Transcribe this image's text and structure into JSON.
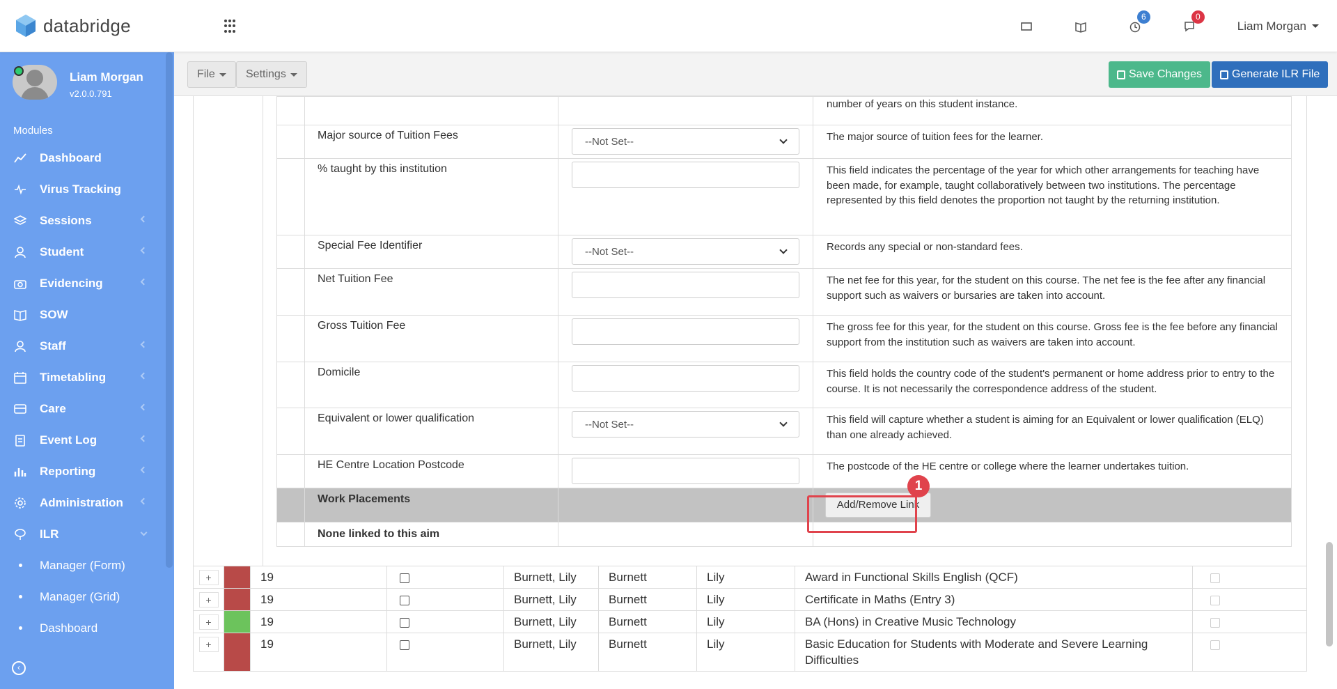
{
  "header": {
    "brand": "databridge",
    "notifications": {
      "timers_badge": "6",
      "messages_badge": "0"
    },
    "user_name": "Liam Morgan"
  },
  "sidebar": {
    "profile": {
      "name": "Liam Morgan",
      "version": "v2.0.0.791"
    },
    "modules_label": "Modules",
    "items": [
      {
        "label": "Dashboard",
        "icon": "chart-line-icon",
        "has_children": false
      },
      {
        "label": "Virus Tracking",
        "icon": "heartbeat-icon",
        "has_children": false
      },
      {
        "label": "Sessions",
        "icon": "layers-icon",
        "has_children": true
      },
      {
        "label": "Student",
        "icon": "user-icon",
        "has_children": true
      },
      {
        "label": "Evidencing",
        "icon": "camera-icon",
        "has_children": true
      },
      {
        "label": "SOW",
        "icon": "book-icon",
        "has_children": false
      },
      {
        "label": "Staff",
        "icon": "user-icon",
        "has_children": true
      },
      {
        "label": "Timetabling",
        "icon": "calendar-icon",
        "has_children": true
      },
      {
        "label": "Care",
        "icon": "id-card-icon",
        "has_children": true
      },
      {
        "label": "Event Log",
        "icon": "clipboard-icon",
        "has_children": true
      },
      {
        "label": "Reporting",
        "icon": "bar-chart-icon",
        "has_children": true
      },
      {
        "label": "Administration",
        "icon": "gear-icon",
        "has_children": true
      },
      {
        "label": "ILR",
        "icon": "balloon-icon",
        "has_children": true
      }
    ],
    "sub_items": [
      {
        "label": "Manager (Form)"
      },
      {
        "label": "Manager (Grid)"
      },
      {
        "label": "Dashboard"
      }
    ]
  },
  "toolbar": {
    "file_label": "File",
    "settings_label": "Settings",
    "save_label": "Save Changes",
    "generate_label": "Generate ILR File"
  },
  "detail_rows": {
    "top_partial_desc": "number of years on this student instance.",
    "rows": [
      {
        "label": "Major source of Tuition Fees",
        "control": "select",
        "value": "--Not Set--",
        "description": "The major source of tuition fees for the learner."
      },
      {
        "label": "% taught by this institution",
        "control": "input",
        "value": "",
        "description": "This field indicates the percentage of the year for which other arrangements for teaching have been made, for example, taught collaboratively between two institutions. The percentage represented by this field denotes the proportion not taught by the returning institution."
      },
      {
        "label": "Special Fee Identifier",
        "control": "select",
        "value": "--Not Set--",
        "description": "Records any special or non-standard fees."
      },
      {
        "label": "Net Tuition Fee",
        "control": "input",
        "value": "",
        "description": "The net fee for this year, for the student on this course. The net fee is the fee after any financial support such as waivers or bursaries are taken into account."
      },
      {
        "label": "Gross Tuition Fee",
        "control": "input",
        "value": "",
        "description": "The gross fee for this year, for the student on this course. Gross fee is the fee before any financial support from the institution such as waivers are taken into account."
      },
      {
        "label": "Domicile",
        "control": "input",
        "value": "",
        "description": "This field holds the country code of the student's permanent or home address prior to entry to the course. It is not necessarily the correspondence address of the student."
      },
      {
        "label": "Equivalent or lower qualification",
        "control": "select",
        "value": "--Not Set--",
        "description": "This field will capture whether a student is aiming for an Equivalent or lower qualification (ELQ) than one already achieved."
      },
      {
        "label": "HE Centre Location Postcode",
        "control": "input",
        "value": "",
        "description": "The postcode of the HE centre or college where the learner undertakes tuition."
      }
    ],
    "work_placements_label": "Work Placements",
    "add_remove_label": "Add/Remove Link",
    "none_linked_label": "None linked to this aim",
    "marker": "1"
  },
  "grid_rows": [
    {
      "plus": "+",
      "status_color": "#b84a48",
      "year": "19",
      "full_name": "Burnett, Lily",
      "surname": "Burnett",
      "first_name": "Lily",
      "course": "Award in Functional Skills English (QCF)"
    },
    {
      "plus": "+",
      "status_color": "#b84a48",
      "year": "19",
      "full_name": "Burnett, Lily",
      "surname": "Burnett",
      "first_name": "Lily",
      "course": "Certificate in Maths (Entry 3)"
    },
    {
      "plus": "+",
      "status_color": "#6cc35c",
      "year": "19",
      "full_name": "Burnett, Lily",
      "surname": "Burnett",
      "first_name": "Lily",
      "course": "BA (Hons) in Creative Music Technology"
    },
    {
      "plus": "+",
      "status_color": "#b84a48",
      "year": "19",
      "full_name": "Burnett, Lily",
      "surname": "Burnett",
      "first_name": "Lily",
      "course": "Basic Education for Students with Moderate and Severe Learning Difficulties"
    }
  ]
}
